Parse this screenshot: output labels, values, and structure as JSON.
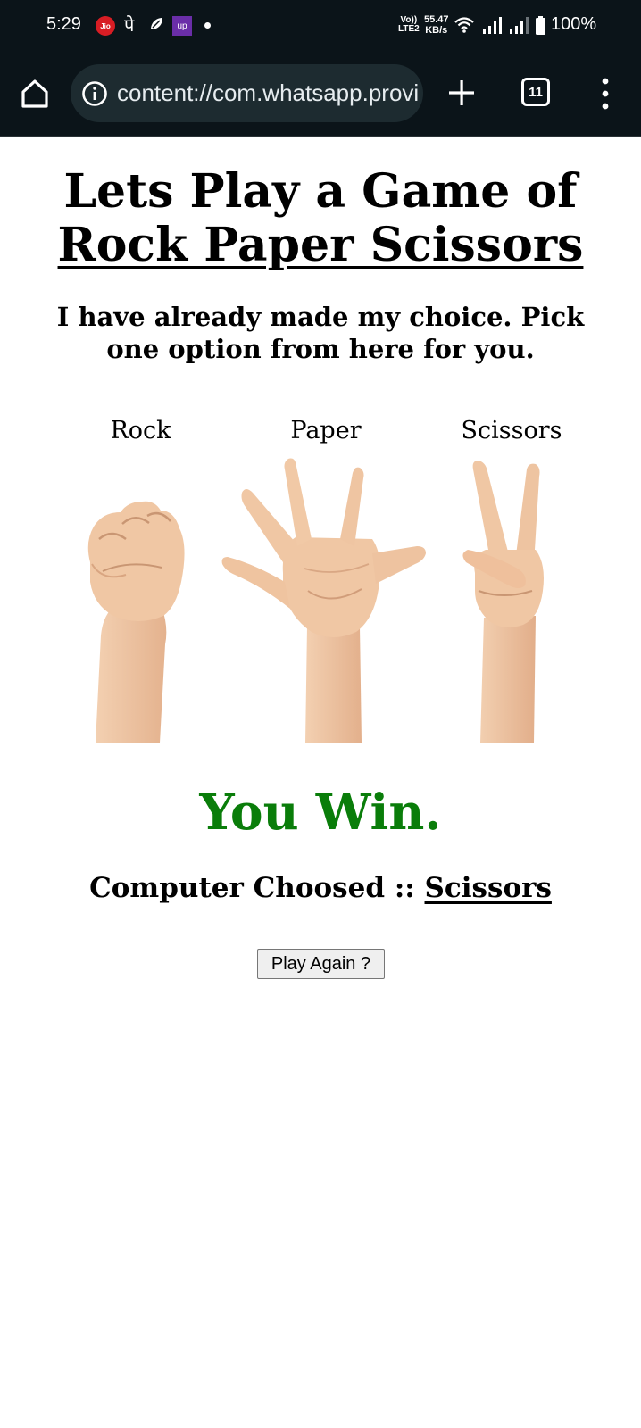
{
  "status_bar": {
    "time": "5:29",
    "jio_label": "Jio",
    "pe_label": "पे",
    "up_label": "up",
    "volte_label_1": "Vo))",
    "volte_label_2": "LTE2",
    "speed_value": "55.47",
    "speed_unit": "KB/s",
    "battery_percent": "100%"
  },
  "browser": {
    "url": "content://com.whatsapp.provider.media/item/",
    "tab_count": "11"
  },
  "page": {
    "title_line1": "Lets Play a Game of",
    "title_line2": "Rock Paper Scissors",
    "subtitle": "I have already made my choice. Pick one option from here for you.",
    "choices": [
      {
        "label": "Rock",
        "icon": "rock-fist-icon"
      },
      {
        "label": "Paper",
        "icon": "paper-hand-icon"
      },
      {
        "label": "Scissors",
        "icon": "scissors-hand-icon"
      }
    ],
    "result_text": "You Win.",
    "computer_choice_label": "Computer Choosed ::",
    "computer_choice_value": "Scissors",
    "play_again_label": "Play Again ?",
    "colors": {
      "result_green": "#0a7d0a",
      "skin": "#f0c7a4",
      "toolbar_bg": "#0b1419"
    }
  }
}
